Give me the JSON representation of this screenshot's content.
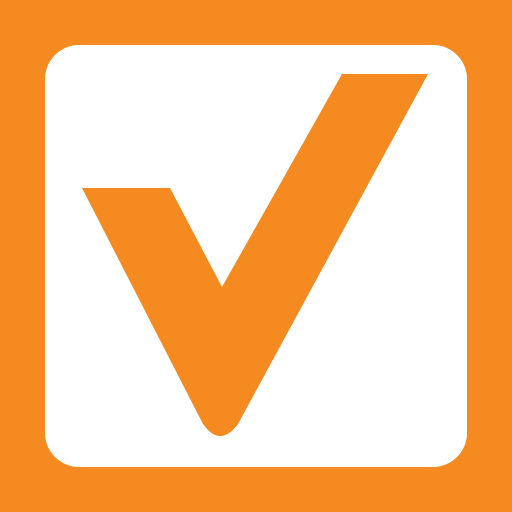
{
  "icon": {
    "name": "checkmark-app-icon",
    "background_color": "#F58A20",
    "tile_color": "#FFFFFF",
    "check_color": "#F58A20"
  }
}
